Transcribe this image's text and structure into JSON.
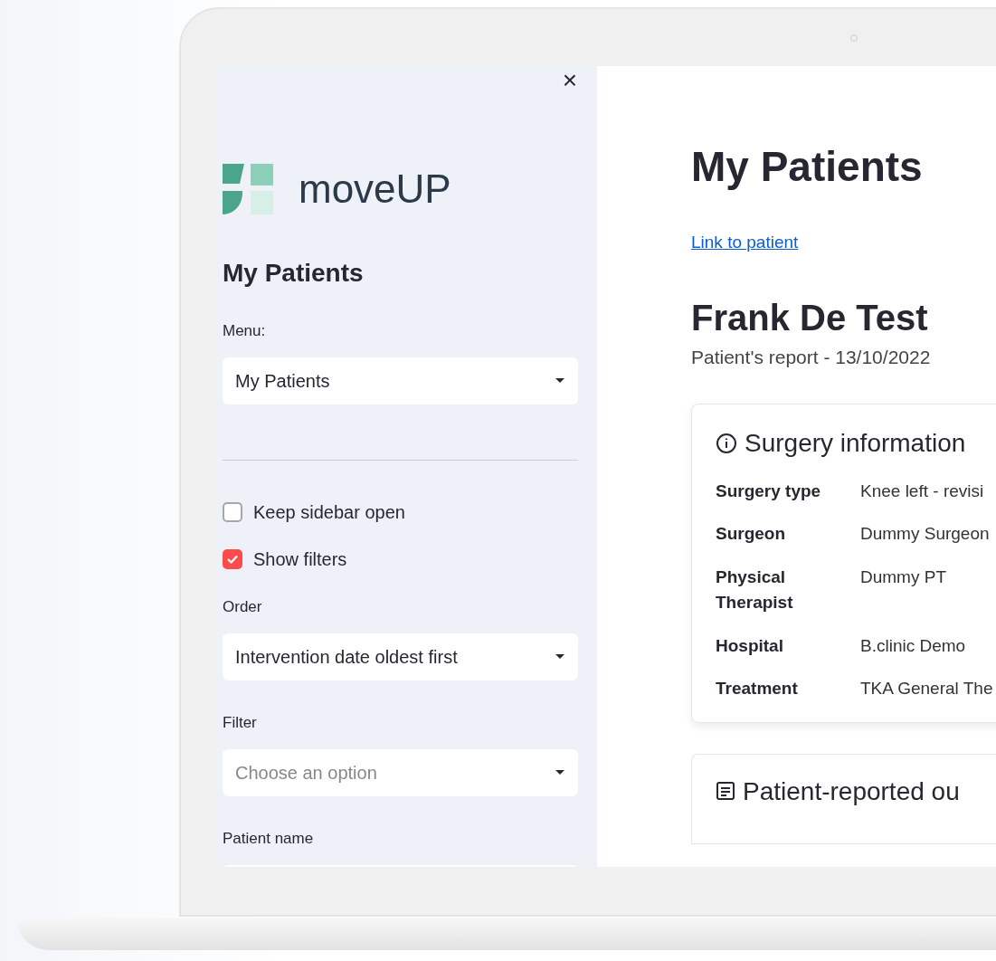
{
  "sidebar": {
    "close": "×",
    "logo_text": "moveUP",
    "title": "My Patients",
    "menu_label": "Menu:",
    "menu_value": "My Patients",
    "checkboxes": [
      {
        "label": "Keep sidebar open",
        "checked": false
      },
      {
        "label": "Show filters",
        "checked": true
      }
    ],
    "order_label": "Order",
    "order_value": "Intervention date oldest first",
    "filter_label": "Filter",
    "filter_placeholder": "Choose an option",
    "patient_name_label": "Patient name"
  },
  "main": {
    "title": "My Patients",
    "link": "Link to patient",
    "patient_name": "Frank De Test",
    "report_subtitle": "Patient's report - 13/10/2022",
    "surgery_card": {
      "title": "Surgery information",
      "rows": [
        {
          "label": "Surgery type",
          "value": "Knee left - revisi"
        },
        {
          "label": "Surgeon",
          "value": "Dummy Surgeon"
        },
        {
          "label": "Physical Therapist",
          "value": "Dummy PT"
        },
        {
          "label": "Hospital",
          "value": "B.clinic Demo"
        },
        {
          "label": "Treatment",
          "value": "TKA General The"
        }
      ]
    },
    "outcomes_card": {
      "title": "Patient-reported ou"
    }
  }
}
